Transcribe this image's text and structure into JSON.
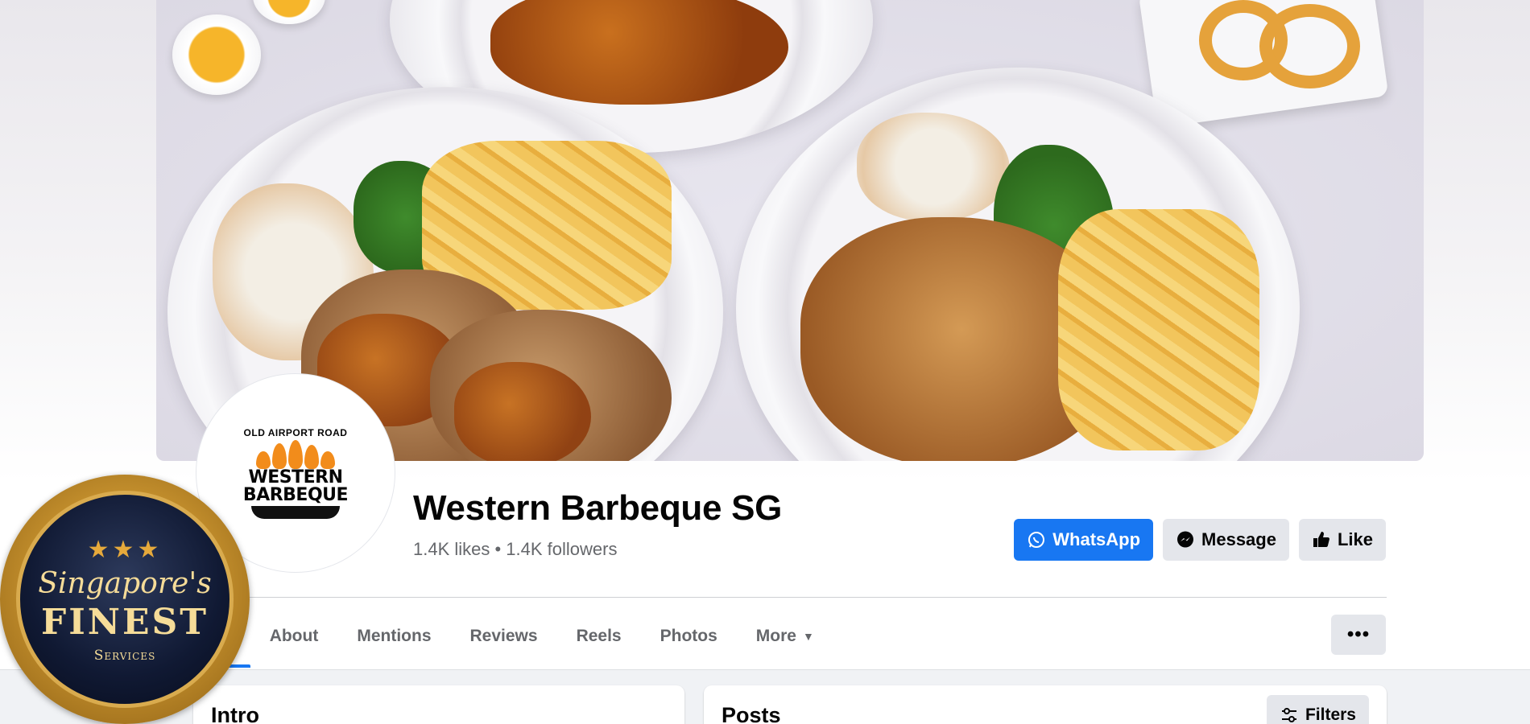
{
  "page": {
    "title": "Western Barbeque SG",
    "stats": "1.4K likes • 1.4K followers"
  },
  "profile_logo": {
    "top_text": "OLD AIRPORT ROAD",
    "name_line1": "WESTERN",
    "name_line2": "BARBEQUE"
  },
  "actions": {
    "whatsapp": "WhatsApp",
    "message": "Message",
    "like": "Like"
  },
  "tabs": [
    {
      "label": "ts",
      "active": true
    },
    {
      "label": "About"
    },
    {
      "label": "Mentions"
    },
    {
      "label": "Reviews"
    },
    {
      "label": "Reels"
    },
    {
      "label": "Photos"
    },
    {
      "label": "More"
    }
  ],
  "more_options": "•••",
  "cards": {
    "intro_title": "Intro",
    "posts_title": "Posts",
    "filters_label": "Filters"
  },
  "badge": {
    "stars": "★★★",
    "line1": "Singapore's",
    "line2": "FINEST",
    "line3": "Services"
  },
  "colors": {
    "accent": "#1877f2",
    "secondary_button": "#e4e6eb",
    "muted_text": "#65676b"
  }
}
